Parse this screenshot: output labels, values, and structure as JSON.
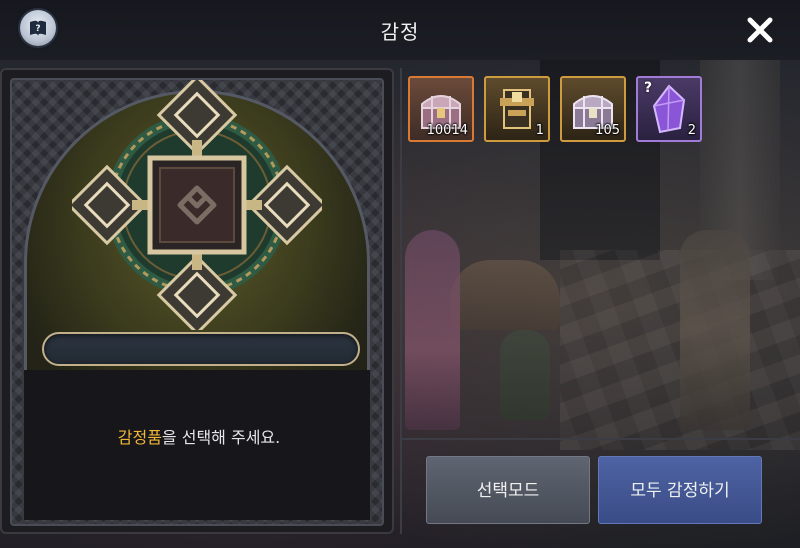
{
  "header": {
    "title": "감정"
  },
  "left": {
    "prompt_highlight": "감정품",
    "prompt_rest": "을 선택해 주세요."
  },
  "inventory": {
    "items": [
      {
        "name": "ornate-chest-icon",
        "qty": "10014",
        "frame": "orange"
      },
      {
        "name": "golden-armor-chest-icon",
        "qty": "1",
        "frame": "gold"
      },
      {
        "name": "silver-chest-icon",
        "qty": "105",
        "frame": "gold"
      },
      {
        "name": "purple-crystal-icon",
        "qty": "2",
        "frame": "purple",
        "unknown_mark": "?"
      }
    ]
  },
  "buttons": {
    "select_mode": "선택모드",
    "appraise_all": "모두 감정하기"
  },
  "colors": {
    "highlight": "#f1b738",
    "select_button": "#545a65",
    "appraise_button": "#4458966"
  }
}
